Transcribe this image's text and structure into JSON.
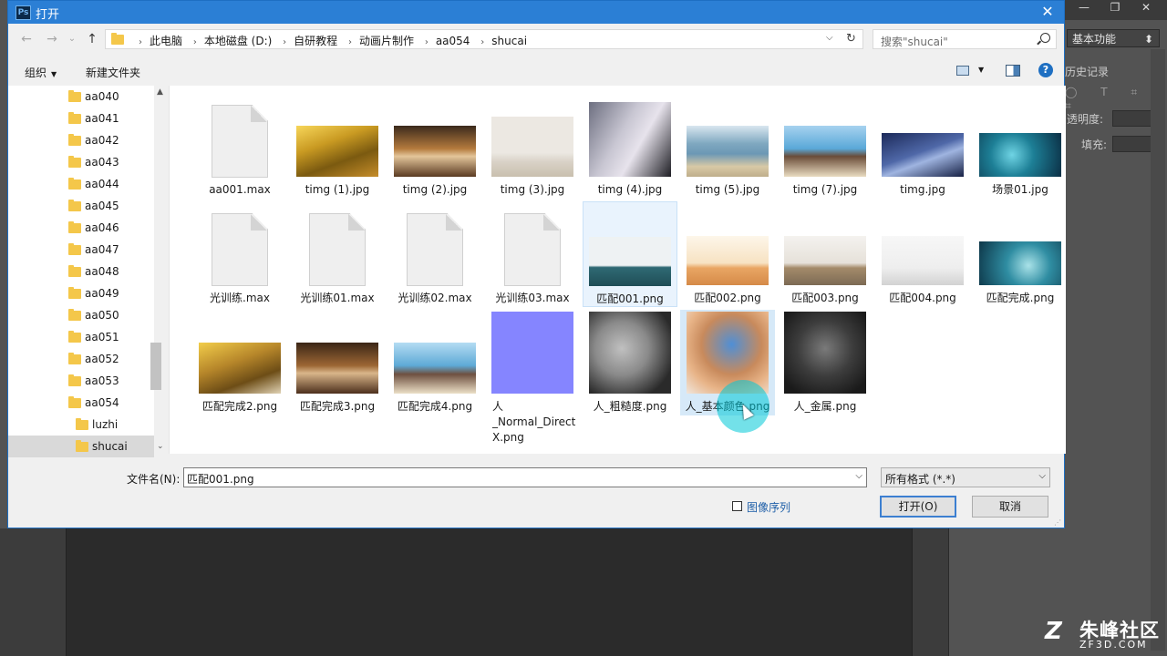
{
  "dialog": {
    "title": "打开",
    "close": "✕",
    "address": {
      "crumbs": [
        "此电脑",
        "本地磁盘 (D:)",
        "自研教程",
        "动画片制作",
        "aa054",
        "shucai"
      ],
      "sep": "›",
      "dropdown": "⌵",
      "refresh": "↻"
    },
    "search_placeholder": "搜索\"shucai\"",
    "nav": {
      "back": "←",
      "forward": "→",
      "recent": "⌄",
      "up": "↑"
    },
    "toolbar": {
      "organize": "组织",
      "organize_caret": "▼",
      "new_folder": "新建文件夹",
      "view_caret": "▼",
      "help": "?"
    },
    "tree": [
      {
        "label": "aa040"
      },
      {
        "label": "aa041"
      },
      {
        "label": "aa042"
      },
      {
        "label": "aa043"
      },
      {
        "label": "aa044"
      },
      {
        "label": "aa045"
      },
      {
        "label": "aa046"
      },
      {
        "label": "aa047"
      },
      {
        "label": "aa048"
      },
      {
        "label": "aa049"
      },
      {
        "label": "aa050"
      },
      {
        "label": "aa051"
      },
      {
        "label": "aa052"
      },
      {
        "label": "aa053"
      },
      {
        "label": "aa054"
      },
      {
        "label": "luzhi"
      },
      {
        "label": "shucai"
      }
    ],
    "scroll": {
      "up": "▲",
      "down": "⌄"
    },
    "files": [
      {
        "name": "aa001.max"
      },
      {
        "name": "timg (1).jpg"
      },
      {
        "name": "timg (2).jpg"
      },
      {
        "name": "timg (3).jpg"
      },
      {
        "name": "timg (4).jpg"
      },
      {
        "name": "timg (5).jpg"
      },
      {
        "name": "timg (7).jpg"
      },
      {
        "name": "timg.jpg"
      },
      {
        "name": "场景01.jpg"
      },
      {
        "name": "光训练.max"
      },
      {
        "name": "光训练01.max"
      },
      {
        "name": "光训练02.max"
      },
      {
        "name": "光训练03.max"
      },
      {
        "name": "匹配001.png"
      },
      {
        "name": "匹配002.png"
      },
      {
        "name": "匹配003.png"
      },
      {
        "name": "匹配004.png"
      },
      {
        "name": "匹配完成.png"
      },
      {
        "name": "匹配完成2.png"
      },
      {
        "name": "匹配完成3.png"
      },
      {
        "name": "匹配完成4.png"
      },
      {
        "name": "人\n_Normal_Direct\nX.png"
      },
      {
        "name": "人_粗糙度.png"
      },
      {
        "name": "人_基本颜色.png"
      },
      {
        "name": "人_金属.png"
      }
    ],
    "filename_label": "文件名(N):",
    "filename_value": "匹配001.png",
    "filetype_value": "所有格式 (*.*)",
    "dropdown_caret": "⌵",
    "image_sequence": "图像序列",
    "open_button": "打开(O)",
    "cancel_button": "取消",
    "grip": "⋰"
  },
  "photoshop": {
    "workspace": "基本功能",
    "workspace_caret": "⬍",
    "history_tab": "历史记录",
    "opacity_label": "透明度:",
    "fill_label": "填充:",
    "tool_icons": "◯ T ⌗ ⌗",
    "window_buttons": [
      "—",
      "❐",
      "✕"
    ]
  },
  "watermark": {
    "logo": "Z",
    "cn": "朱峰社区",
    "en": "ZF3D.COM"
  },
  "colors": {
    "accent": "#2b7fd5",
    "selection": "#e9f3fd",
    "cursor_ring": "#00c8d7"
  }
}
